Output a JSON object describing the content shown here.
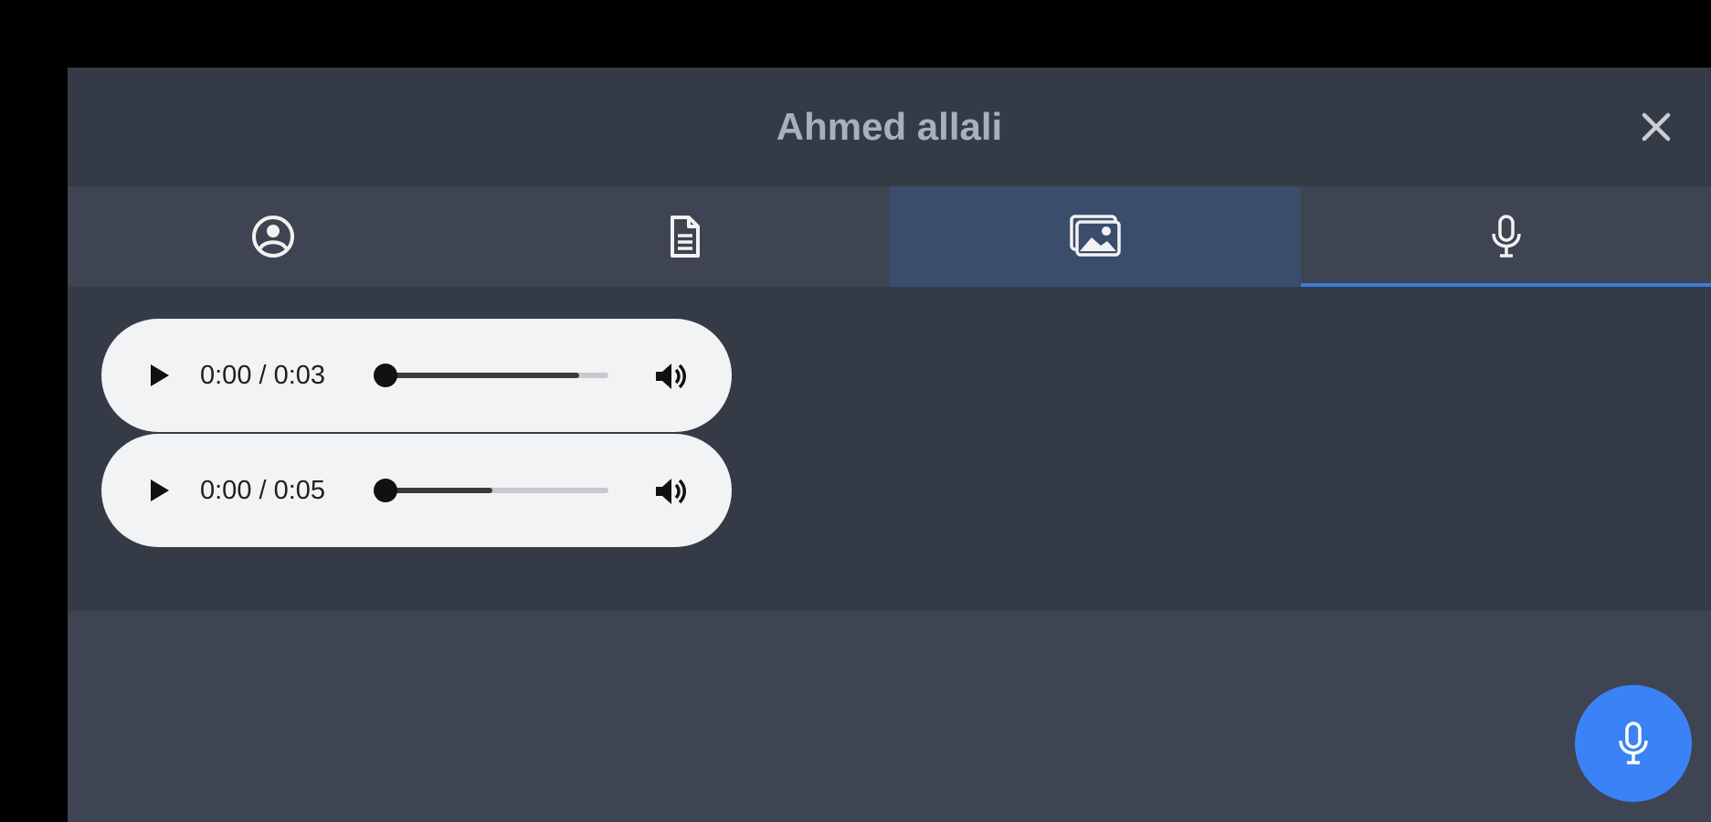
{
  "dialog": {
    "title": "Ahmed allali",
    "close_icon": "close-icon"
  },
  "tabs": [
    {
      "icon": "user-circle-icon",
      "selected": false
    },
    {
      "icon": "document-icon",
      "selected": false
    },
    {
      "icon": "images-icon",
      "selected": false,
      "highlighted": true
    },
    {
      "icon": "microphone-icon",
      "selected": true
    }
  ],
  "audio_clips": [
    {
      "time": "0:00 / 0:03",
      "progress": 0,
      "buffered": 0.87
    },
    {
      "time": "0:00 / 0:05",
      "progress": 0,
      "buffered": 0.48
    }
  ],
  "record_button": {
    "icon": "microphone-icon"
  },
  "colors": {
    "accent": "#3b82f6",
    "tab_indicator": "#3b7ddd",
    "header_bg": "#353b46",
    "panel_bg": "#3e4451",
    "highlight_tab": "#3a4d6b"
  }
}
